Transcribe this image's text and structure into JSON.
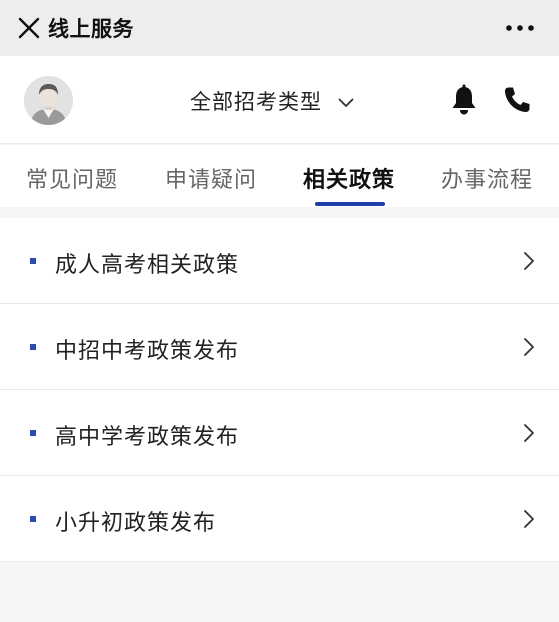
{
  "titlebar": {
    "title": "线上服务",
    "close_icon": "close-icon",
    "more_icon": "more-horizontal-icon"
  },
  "header": {
    "avatar_icon": "user-avatar-icon",
    "selector_label": "全部招考类型",
    "selector_icon": "chevron-down-icon",
    "bell_icon": "bell-icon",
    "phone_icon": "phone-icon"
  },
  "tabs": [
    {
      "label": "常见问题",
      "active": false
    },
    {
      "label": "申请疑问",
      "active": false
    },
    {
      "label": "相关政策",
      "active": true
    },
    {
      "label": "办事流程",
      "active": false
    }
  ],
  "list": {
    "items": [
      {
        "label": "成人高考相关政策"
      },
      {
        "label": "中招中考政策发布"
      },
      {
        "label": "高中学考政策发布"
      },
      {
        "label": "小升初政策发布"
      }
    ],
    "arrow_icon": "chevron-right-icon"
  },
  "colors": {
    "accent": "#1f3fa8",
    "bullet": "#2a4bb8",
    "titlebar_bg": "#ededed",
    "page_bg": "#f6f6f6"
  }
}
